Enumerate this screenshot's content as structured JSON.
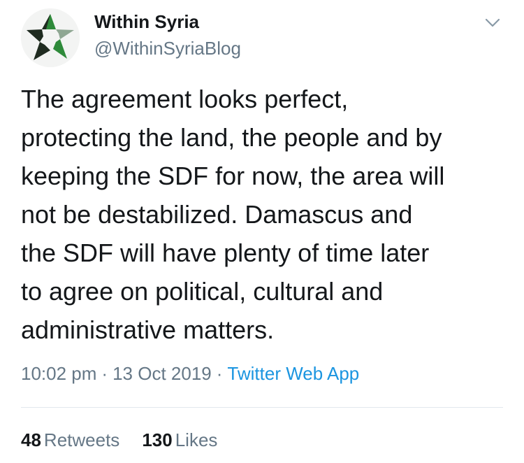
{
  "tweet": {
    "author": {
      "display_name": "Within Syria",
      "handle": "@WithinSyriaBlog"
    },
    "text": "The agreement looks perfect,\nprotecting the land, the people and by\nkeeping the SDF for now, the area will\nnot be destabilized. Damascus and\nthe SDF will have plenty of time later\nto agree on political, cultural and\nadministrative matters.",
    "time": "10:02 pm",
    "date": "13 Oct 2019",
    "separator": "·",
    "source": "Twitter Web App",
    "stats": {
      "retweets_count": "48",
      "retweets_label": "Retweets",
      "likes_count": "130",
      "likes_label": "Likes"
    }
  },
  "icons": {
    "avatar": "star-logo-icon",
    "menu": "chevron-down-icon"
  },
  "colors": {
    "text_primary": "#14171a",
    "text_secondary": "#657786",
    "link": "#1b95e0",
    "divider": "#e1e8ed",
    "star_dark": "#1f2b20",
    "star_green": "#2e8a3a",
    "star_light": "#8fa793"
  }
}
